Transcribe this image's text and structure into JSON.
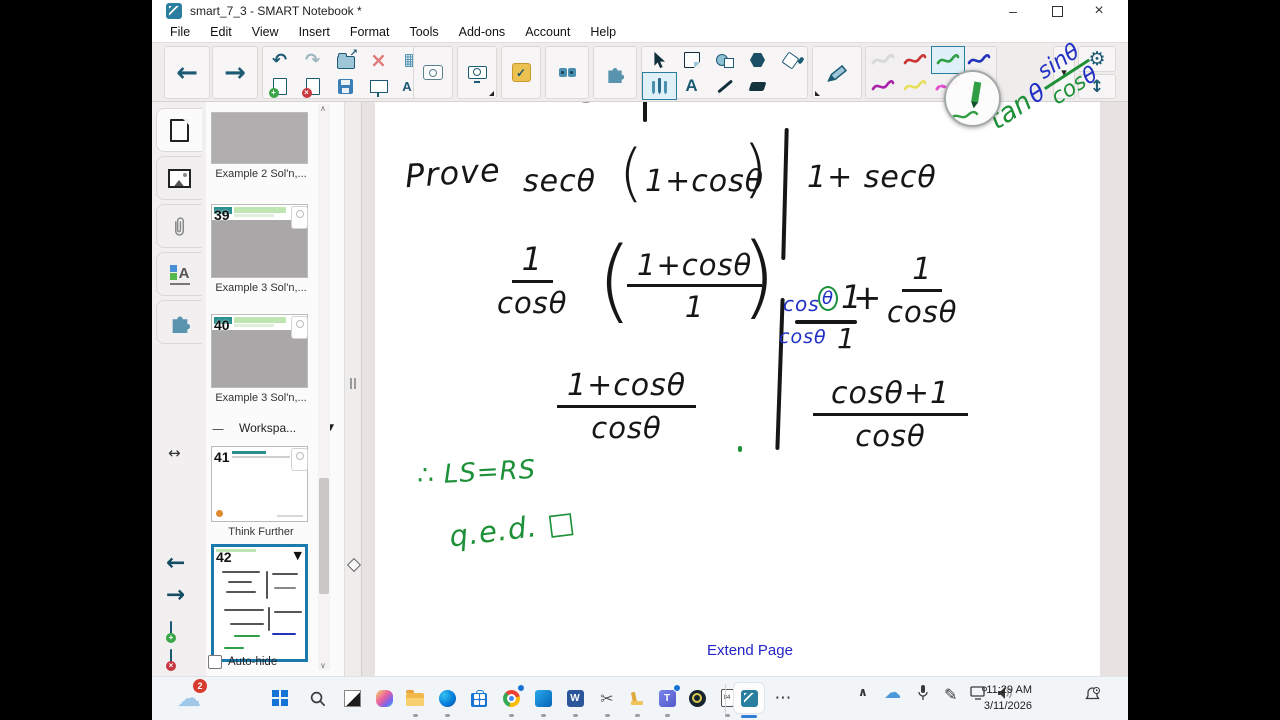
{
  "window": {
    "title": "smart_7_3 - SMART Notebook *",
    "minimize": "–",
    "close": "×"
  },
  "menu": [
    "File",
    "Edit",
    "View",
    "Insert",
    "Format",
    "Tools",
    "Add-ons",
    "Account",
    "Help"
  ],
  "icons": {
    "back": "←",
    "forward": "→",
    "undo": "↶",
    "redo": "↷",
    "delete": "×",
    "table": "▦",
    "export_arrow": "↗",
    "check": "✓",
    "text_tool": "A",
    "measure_letter": "A",
    "dropdown": "▾",
    "gear": "⚙",
    "toolbar_resize": "↕",
    "panel_flip": "↔",
    "group_minus": "—",
    "tri_down": "▼",
    "scroll_up": "∧",
    "scroll_down": "∨",
    "weather": "☁",
    "snip": "✂",
    "pen": "✎",
    "word": "W",
    "teams": "T",
    "overflow": "⋯",
    "tray_up": "∧",
    "onedrive": "☁"
  },
  "sidebar": {
    "group_label": "Workspa...",
    "autohide": "Auto-hide",
    "thumbs": [
      {
        "number": "",
        "label": "Example 2 Sol'n,..."
      },
      {
        "number": "39",
        "label": "Example 3 Sol'n,..."
      },
      {
        "number": "40",
        "label": "Example 3 Sol'n,..."
      },
      {
        "number": "41",
        "label": "Think Further"
      },
      {
        "number": "42",
        "label": ""
      }
    ]
  },
  "canvas": {
    "extend_page": "Extend Page",
    "ink": {
      "clipped": "LS",
      "prove": "Prove",
      "sec_pre": "secθ",
      "paren_open": "(",
      "sec_inner": "1+cosθ",
      "paren_close": ")",
      "rs_line1": "1+ secθ",
      "fracA_num": "1",
      "fracA_den": "cosθ",
      "fracP_num": "1+cosθ",
      "fracP_den": "1",
      "annot_cos_top": "cos",
      "annot_theta_top": "θ",
      "annot_one_top": "1",
      "annot_cos_bot": "cosθ",
      "annot_one_bot": "1",
      "plus": "+",
      "fracB_num": "1",
      "fracB_den": "cosθ",
      "fracC_num": "1+cosθ",
      "fracC_den": "cosθ",
      "fracD_num": "cosθ+1",
      "fracD_den": "cosθ",
      "conclusion": "∴ LS=RS",
      "qed": "q.e.d. □",
      "note_tan": "tan",
      "note_theta": "θ",
      "note_sin": "sinθ",
      "note_cos": "cos",
      "note_cos_theta": "θ"
    }
  },
  "taskbar": {
    "weather_badge": "2",
    "phone_label": "84",
    "time": "11:29 AM",
    "date": "3/11/2026"
  },
  "colors": {
    "ink": "#161616",
    "blue_ink": "#2130c4",
    "green_ink": "#1d9038",
    "teal": "#1c5a74",
    "link": "#2424c8",
    "selection": "#1a79ad"
  }
}
